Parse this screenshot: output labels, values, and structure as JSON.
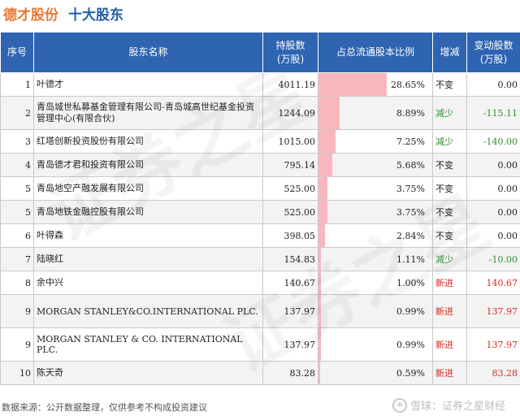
{
  "title": {
    "company": "德才股份",
    "section": "十大股东"
  },
  "headers": {
    "index": "序号",
    "name": "股东名称",
    "shares_line1": "持股数",
    "shares_line2": "(万股)",
    "ratio": "占总流通股本比例",
    "status": "增减",
    "change_line1": "变动股数",
    "change_line2": "(万股)"
  },
  "colors": {
    "header_bg": "#2e64b1",
    "bar": "#f7b7bd",
    "increase": "#d8271f",
    "decrease": "#2f8f2f"
  },
  "rows": [
    {
      "index": "1",
      "name": "叶德才",
      "shares": "4011.19",
      "ratio": "28.65%",
      "ratio_value": 28.65,
      "status": "不变",
      "status_type": "same",
      "change": "0.00"
    },
    {
      "index": "2",
      "name": "青岛城世私募基金管理有限公司-青岛城高世纪基金投资管理中心(有限合伙)",
      "shares": "1244.09",
      "ratio": "8.89%",
      "ratio_value": 8.89,
      "status": "减少",
      "status_type": "down",
      "change": "-115.11"
    },
    {
      "index": "3",
      "name": "红塔创新投资股份有限公司",
      "shares": "1015.00",
      "ratio": "7.25%",
      "ratio_value": 7.25,
      "status": "减少",
      "status_type": "down",
      "change": "-140.00"
    },
    {
      "index": "4",
      "name": "青岛德才君和投资有限公司",
      "shares": "795.14",
      "ratio": "5.68%",
      "ratio_value": 5.68,
      "status": "不变",
      "status_type": "same",
      "change": "0.00"
    },
    {
      "index": "5",
      "name": "青岛地空产融发展有限公司",
      "shares": "525.00",
      "ratio": "3.75%",
      "ratio_value": 3.75,
      "status": "不变",
      "status_type": "same",
      "change": "0.00"
    },
    {
      "index": "5",
      "name": "青岛地铁金融控股有限公司",
      "shares": "525.00",
      "ratio": "3.75%",
      "ratio_value": 3.75,
      "status": "不变",
      "status_type": "same",
      "change": "0.00"
    },
    {
      "index": "6",
      "name": "叶得森",
      "shares": "398.05",
      "ratio": "2.84%",
      "ratio_value": 2.84,
      "status": "不变",
      "status_type": "same",
      "change": "0.00"
    },
    {
      "index": "7",
      "name": "陆晓红",
      "shares": "154.83",
      "ratio": "1.11%",
      "ratio_value": 1.11,
      "status": "减少",
      "status_type": "down",
      "change": "-10.00"
    },
    {
      "index": "8",
      "name": "余中兴",
      "shares": "140.67",
      "ratio": "1.00%",
      "ratio_value": 1.0,
      "status": "新进",
      "status_type": "new",
      "change": "140.67"
    },
    {
      "index": "9",
      "name": "MORGAN STANLEY&CO.INTERNATIONAL PLC.",
      "shares": "137.97",
      "ratio": "0.99%",
      "ratio_value": 0.99,
      "status": "新进",
      "status_type": "new",
      "change": "137.97"
    },
    {
      "index": "9",
      "name": "MORGAN STANLEY & CO. INTERNATIONAL PLC.",
      "shares": "137.97",
      "ratio": "0.99%",
      "ratio_value": 0.99,
      "status": "新进",
      "status_type": "new",
      "change": "137.97"
    },
    {
      "index": "10",
      "name": "陈天奇",
      "shares": "83.28",
      "ratio": "0.59%",
      "ratio_value": 0.59,
      "status": "新进",
      "status_type": "new",
      "change": "83.28"
    }
  ],
  "footer": {
    "source": "数据来源：公开数据整理，仅供参考不构成投资建议",
    "brand": "雪球：证券之星财经"
  },
  "watermark": "证券之星"
}
